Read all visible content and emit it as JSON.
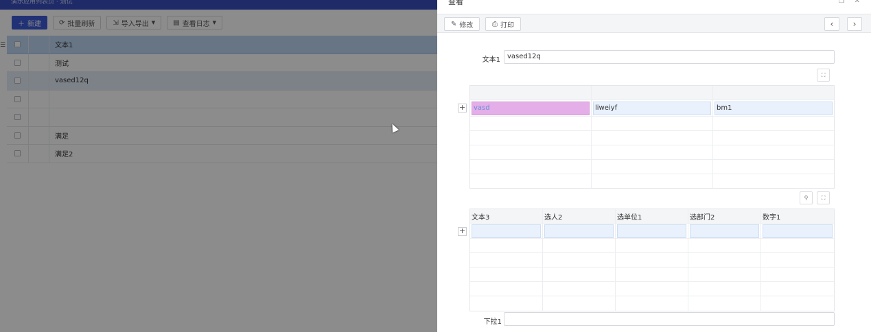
{
  "app": {
    "header_text": "演示应用列表页 · 测试",
    "toolbar": {
      "new_label": "新建",
      "batch_refresh_label": "批量刷新",
      "import_export_label": "导入导出",
      "view_log_label": "查看日志"
    },
    "grid": {
      "column_header": "文本1",
      "rows": [
        {
          "text": "测试",
          "selected": false
        },
        {
          "text": "vased12q",
          "selected": true
        },
        {
          "text": "",
          "selected": false
        },
        {
          "text": "",
          "selected": false
        },
        {
          "text": "满足",
          "selected": false
        },
        {
          "text": "满足2",
          "selected": false
        }
      ]
    }
  },
  "drawer": {
    "title": "查看",
    "edit_label": "修改",
    "print_label": "打印",
    "prev_icon": "chevron-left-icon",
    "next_icon": "chevron-right-icon",
    "field_text1": {
      "label": "文本1",
      "value": "vased12q"
    },
    "subtable1": {
      "headers": [
        "",
        "",
        ""
      ],
      "row_values": [
        "vasd",
        "liweiyf",
        "bm1"
      ]
    },
    "subtable2": {
      "headers": [
        "文本3",
        "选人2",
        "选单位1",
        "选部门2",
        "数字1"
      ],
      "row_values": [
        "",
        "",
        "",
        "",
        ""
      ]
    },
    "field_dropdown1": {
      "label": "下拉1",
      "value": ""
    }
  },
  "colors": {
    "primary": "#3d5ad6",
    "grid_header": "#bcd6f2",
    "highlight_pink": "#e4aee8",
    "input_blue": "#e8f1fc"
  }
}
